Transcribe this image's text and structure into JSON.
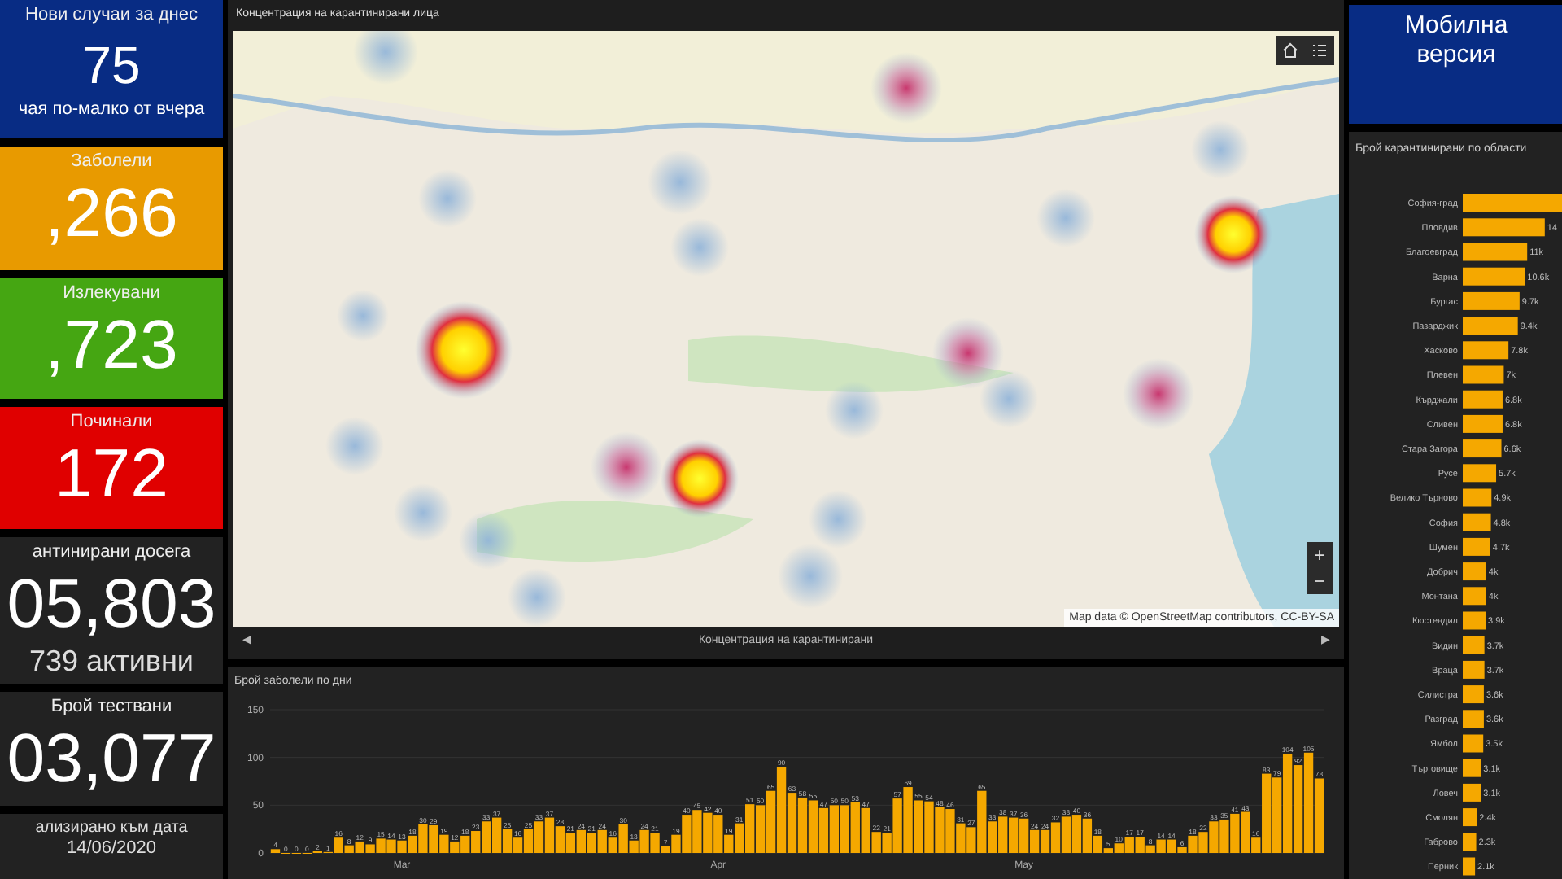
{
  "stats": [
    {
      "kind": "today",
      "title": "Нови случаи за днес",
      "value": "75",
      "note": "чая по-малко от вчера",
      "color": "#082c84"
    },
    {
      "kind": "count",
      "title": "Заболели",
      "value": ",266",
      "color": "#e89a00"
    },
    {
      "kind": "count",
      "title": "Излекувани",
      "value": ",723",
      "color": "#45a612"
    },
    {
      "kind": "count",
      "title": "Починали",
      "value": "172",
      "color": "#e00000"
    },
    {
      "kind": "count",
      "title": "антинирани досега",
      "value": "05,803",
      "note": "739 активни",
      "color": "#222222"
    },
    {
      "kind": "count",
      "title": "Брой тествани",
      "value": "03,077",
      "color": "#222222"
    },
    {
      "kind": "date",
      "title": "ализирано към дата",
      "value": "14/06/2020",
      "color": "#222222"
    }
  ],
  "map": {
    "title": "Концентрация на карантинирани лица",
    "attribution": "Map data © OpenStreetMap contributors, CC-BY-SA",
    "zoom_in": "+",
    "zoom_out": "−",
    "footer": {
      "label": "Концентрация на карантинирани",
      "prev": "◀",
      "next": "▶"
    }
  },
  "daily_chart": {
    "title": "Брой заболели по дни",
    "month_labels": [
      "Mar",
      "Apr",
      "May"
    ],
    "chart_data": {
      "type": "bar",
      "data_labels": true,
      "ylim": [
        0,
        150
      ],
      "yticks": [
        0,
        50,
        100,
        150
      ],
      "series": [
        {
          "color": "#f5a800",
          "values": [
            4,
            0,
            0,
            0,
            2,
            1,
            16,
            8,
            12,
            9,
            15,
            14,
            13,
            18,
            30,
            29,
            19,
            12,
            18,
            23,
            33,
            37,
            25,
            16,
            25,
            33,
            37,
            28,
            21,
            24,
            21,
            24,
            16,
            30,
            13,
            24,
            21,
            7,
            19,
            40,
            45,
            42,
            40,
            19,
            31,
            51,
            50,
            65,
            90,
            63,
            58,
            55,
            47,
            50,
            50,
            53,
            47,
            22,
            21,
            57,
            69,
            55,
            54,
            48,
            46,
            31,
            27,
            65,
            33,
            38,
            37,
            36,
            24,
            24,
            32,
            38,
            40,
            36,
            18,
            5,
            10,
            17,
            17,
            8,
            14,
            14,
            6,
            18,
            22,
            33,
            35,
            41,
            43,
            16,
            83,
            79,
            104,
            92,
            105,
            78
          ]
        }
      ]
    }
  },
  "mobile": {
    "label": "Мобилна версия"
  },
  "region_chart": {
    "title": "Брой карантинирани по области",
    "chart_data": {
      "type": "bar",
      "orientation": "horizontal",
      "categories": [
        "София-град",
        "Пловдив",
        "Благоевград",
        "Варна",
        "Бургас",
        "Пазарджик",
        "Хасково",
        "Плевен",
        "Кърджали",
        "Сливен",
        "Стара Загора",
        "Русе",
        "Велико Търново",
        "София",
        "Шумен",
        "Добрич",
        "Монтана",
        "Кюстендил",
        "Видин",
        "Враца",
        "Силистра",
        "Разград",
        "Ямбол",
        "Търговище",
        "Ловеч",
        "Смолян",
        "Габрово",
        "Перник"
      ],
      "series": [
        {
          "color": "#f5a800",
          "values": [
            null,
            14,
            11,
            10.6,
            9.7,
            9.4,
            7.8,
            7,
            6.8,
            6.8,
            6.6,
            5.7,
            4.9,
            4.8,
            4.7,
            4,
            4,
            3.9,
            3.7,
            3.7,
            3.6,
            3.6,
            3.5,
            3.1,
            3.1,
            2.4,
            2.3,
            2.1
          ],
          "value_labels": [
            null,
            "14",
            "11k",
            "10.6k",
            "9.7k",
            "9.4k",
            "7.8k",
            "7k",
            "6.8k",
            "6.8k",
            "6.6k",
            "5.7k",
            "4.9k",
            "4.8k",
            "4.7k",
            "4k",
            "4k",
            "3.9k",
            "3.7k",
            "3.7k",
            "3.6k",
            "3.6k",
            "3.5k",
            "3.1k",
            "3.1k",
            "2.4k",
            "2.3k",
            "2.1k"
          ]
        }
      ]
    }
  }
}
